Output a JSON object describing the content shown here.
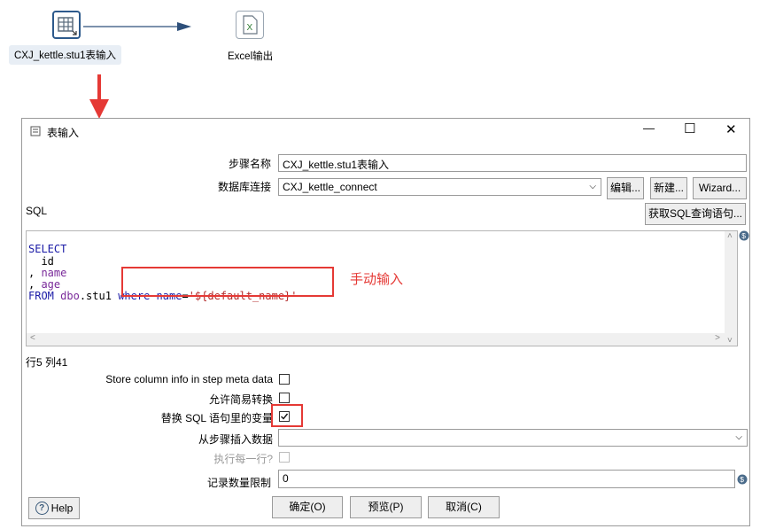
{
  "canvas": {
    "table_input_node_label": "CXJ_kettle.stu1表输入",
    "excel_output_node_label": "Excel输出",
    "annotation_text": "手动输入",
    "colors": {
      "arrow": "#e53935",
      "hop": "#2d4f7a",
      "highlight_box": "#e53935"
    }
  },
  "dialog": {
    "title": "表输入",
    "window_controls": {
      "minimize": "—",
      "maximize": "☐",
      "close": "✕"
    },
    "step_name_label": "步骤名称",
    "step_name_value": "CXJ_kettle.stu1表输入",
    "db_connection_label": "数据库连接",
    "db_connection_value": "CXJ_kettle_connect",
    "edit_button": "编辑...",
    "new_button": "新建...",
    "wizard_button": "Wizard...",
    "sql_label": "SQL",
    "get_sql_button": "获取SQL查询语句...",
    "sql": {
      "line1": "SELECT",
      "line2_id": "id",
      "line3_name": "name",
      "line4_age": "age",
      "line5_from": "FROM",
      "line5_table": "dbo.stu1",
      "line5_where": "where",
      "line5_name_kw": "name",
      "line5_eq": "=",
      "line5_value": "'${default_name}'"
    },
    "cursor_position": "行5 列41",
    "store_column_info_label": "Store column info in step meta data",
    "allow_lazy_conversion_label": "允许简易转换",
    "replace_variables_label": "替换 SQL 语句里的变量",
    "insert_data_from_step_label": "从步骤插入数据",
    "execute_each_row_label": "执行每一行?",
    "limit_label": "记录数量限制",
    "limit_value": "0",
    "checkboxes": {
      "store_column_info": false,
      "allow_lazy_conversion": false,
      "replace_variables": true,
      "execute_each_row": false
    },
    "help_button": "Help",
    "ok_button": "确定(O)",
    "preview_button": "预览(P)",
    "cancel_button": "取消(C)"
  }
}
